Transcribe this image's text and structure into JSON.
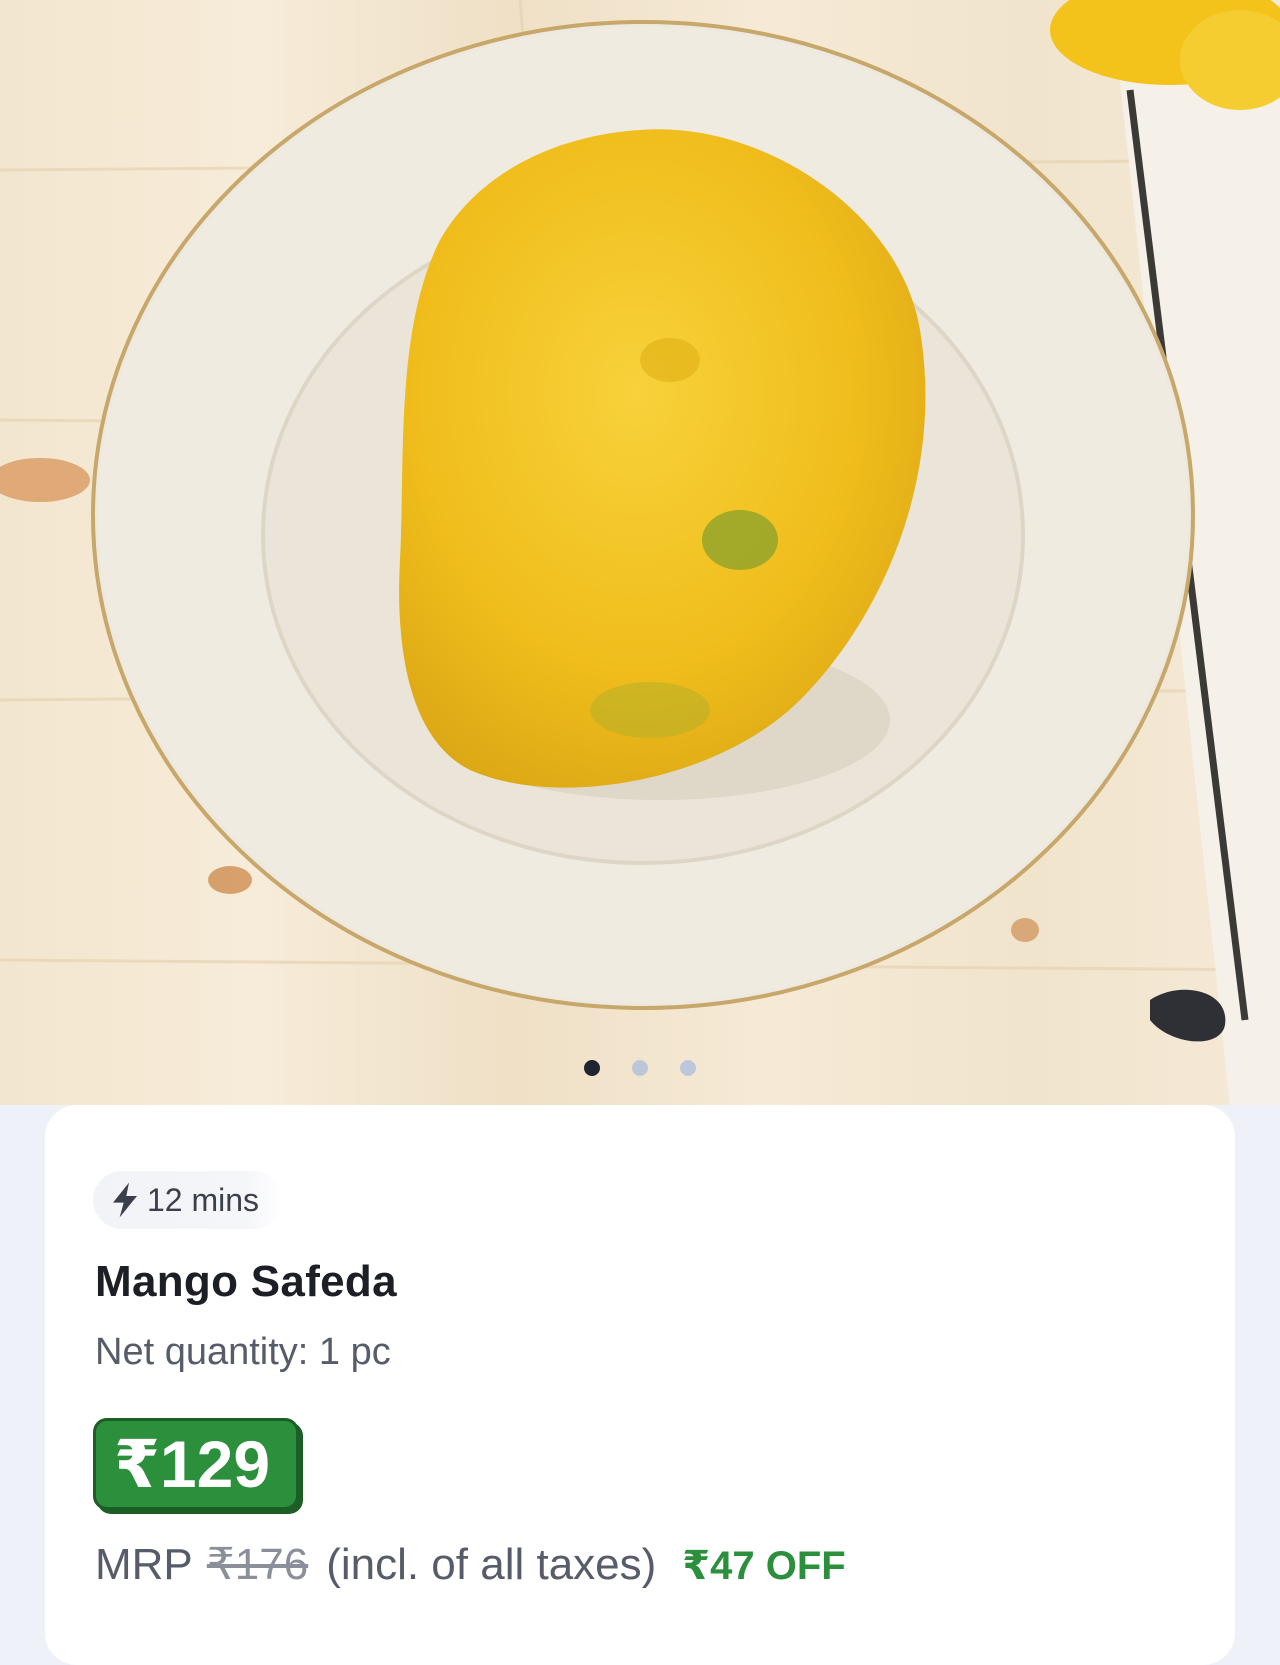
{
  "carousel": {
    "slide_count": 3,
    "active_index": 0
  },
  "product": {
    "eta": "12 mins",
    "eta_icon": "lightning-icon",
    "name": "Mango Safeda",
    "net_quantity": "Net quantity: 1 pc",
    "price": "₹129",
    "mrp_label": "MRP",
    "mrp_value": "₹176",
    "tax_note": "(incl. of all taxes)",
    "discount": "₹47 OFF"
  },
  "colors": {
    "accent_green": "#2b8f3b",
    "mango": "#f2c21f"
  }
}
